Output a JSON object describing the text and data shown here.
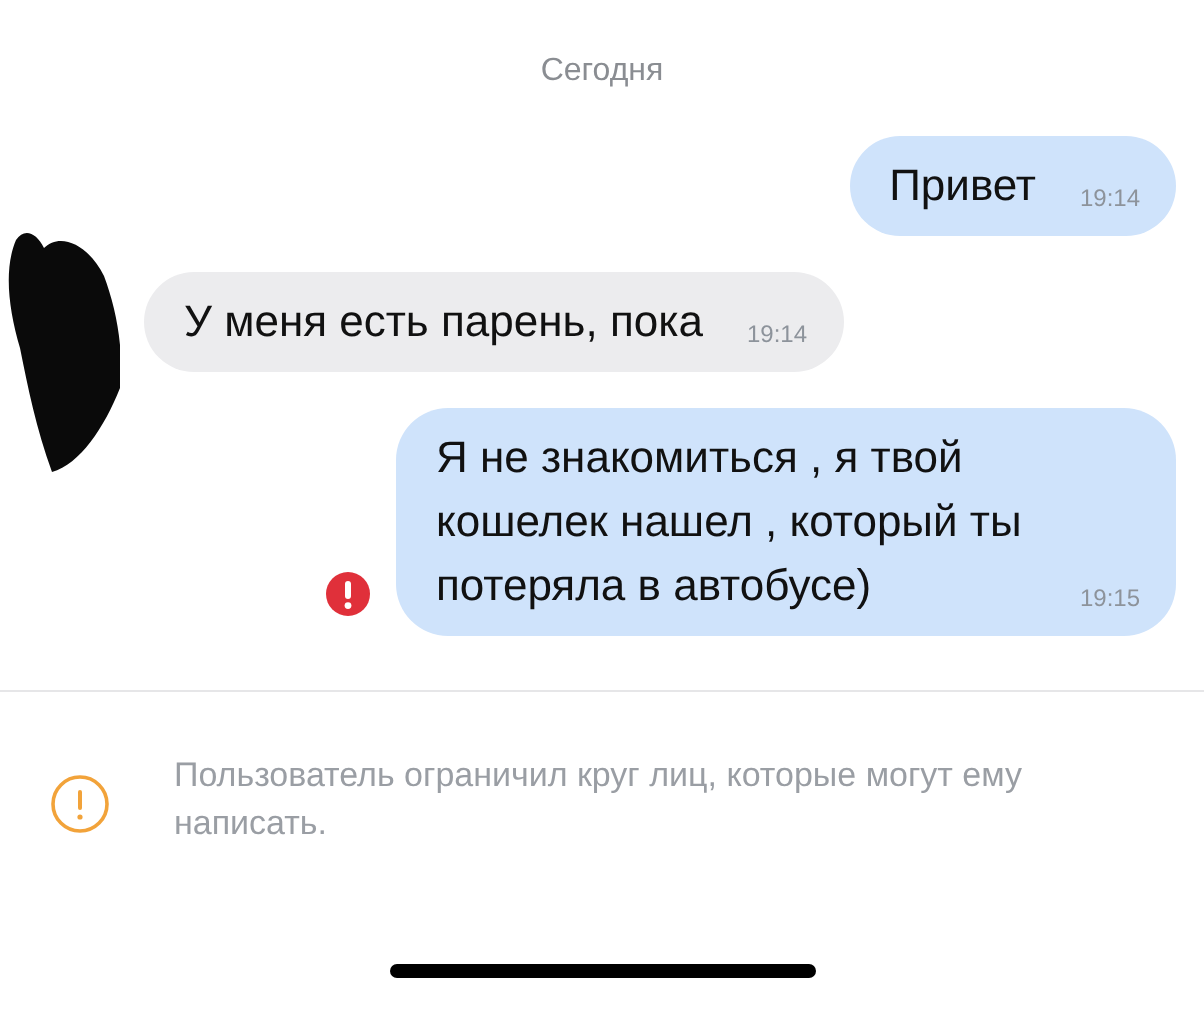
{
  "date_header": "Сегодня",
  "messages": [
    {
      "kind": "outgoing",
      "text": "Привет",
      "time": "19:14",
      "failed": false
    },
    {
      "kind": "incoming",
      "text": "У меня есть парень, пока",
      "time": "19:14",
      "failed": false
    },
    {
      "kind": "outgoing",
      "text": "Я не знакомиться , я твой кошелек нашел , который ты потеряла в автобусе)",
      "time": "19:15",
      "failed": true
    }
  ],
  "notice": {
    "text": "Пользователь ограничил круг лиц, которые могут ему написать."
  }
}
